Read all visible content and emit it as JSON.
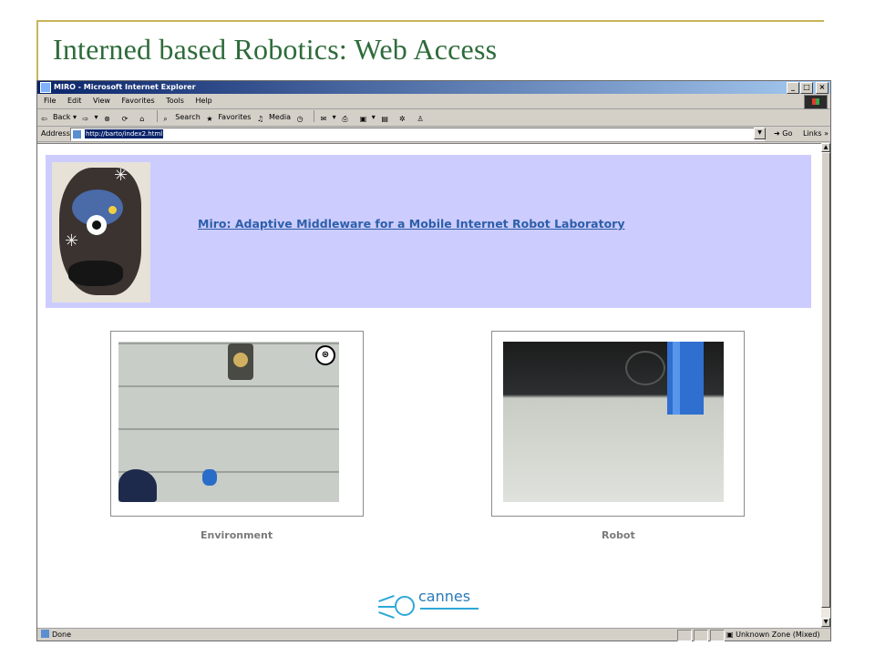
{
  "slide": {
    "title": "Interned based Robotics: Web Access"
  },
  "browser": {
    "window_title": "MIRO - Microsoft Internet Explorer",
    "window_buttons": [
      "_",
      "□",
      "×"
    ],
    "menu": [
      "File",
      "Edit",
      "View",
      "Favorites",
      "Tools",
      "Help"
    ],
    "toolbar": {
      "back": "Back",
      "search": "Search",
      "favorites": "Favorites",
      "media": "Media"
    },
    "address_label": "Address",
    "address_url": "http://barto/index2.html",
    "go_label": "Go",
    "links_label": "Links"
  },
  "page": {
    "header_link": "Miro: Adaptive Middleware for a Mobile Internet Robot Laboratory",
    "captions": {
      "environment": "Environment",
      "robot": "Robot"
    },
    "logo_text": "cannes"
  },
  "status": {
    "left": "Done",
    "zone": "Unknown Zone (Mixed)"
  },
  "colors": {
    "header_band": "#ccccff",
    "title_green": "#2e6b3a",
    "link_blue": "#2d5fa8",
    "logo_blue": "#2a7ab8"
  }
}
